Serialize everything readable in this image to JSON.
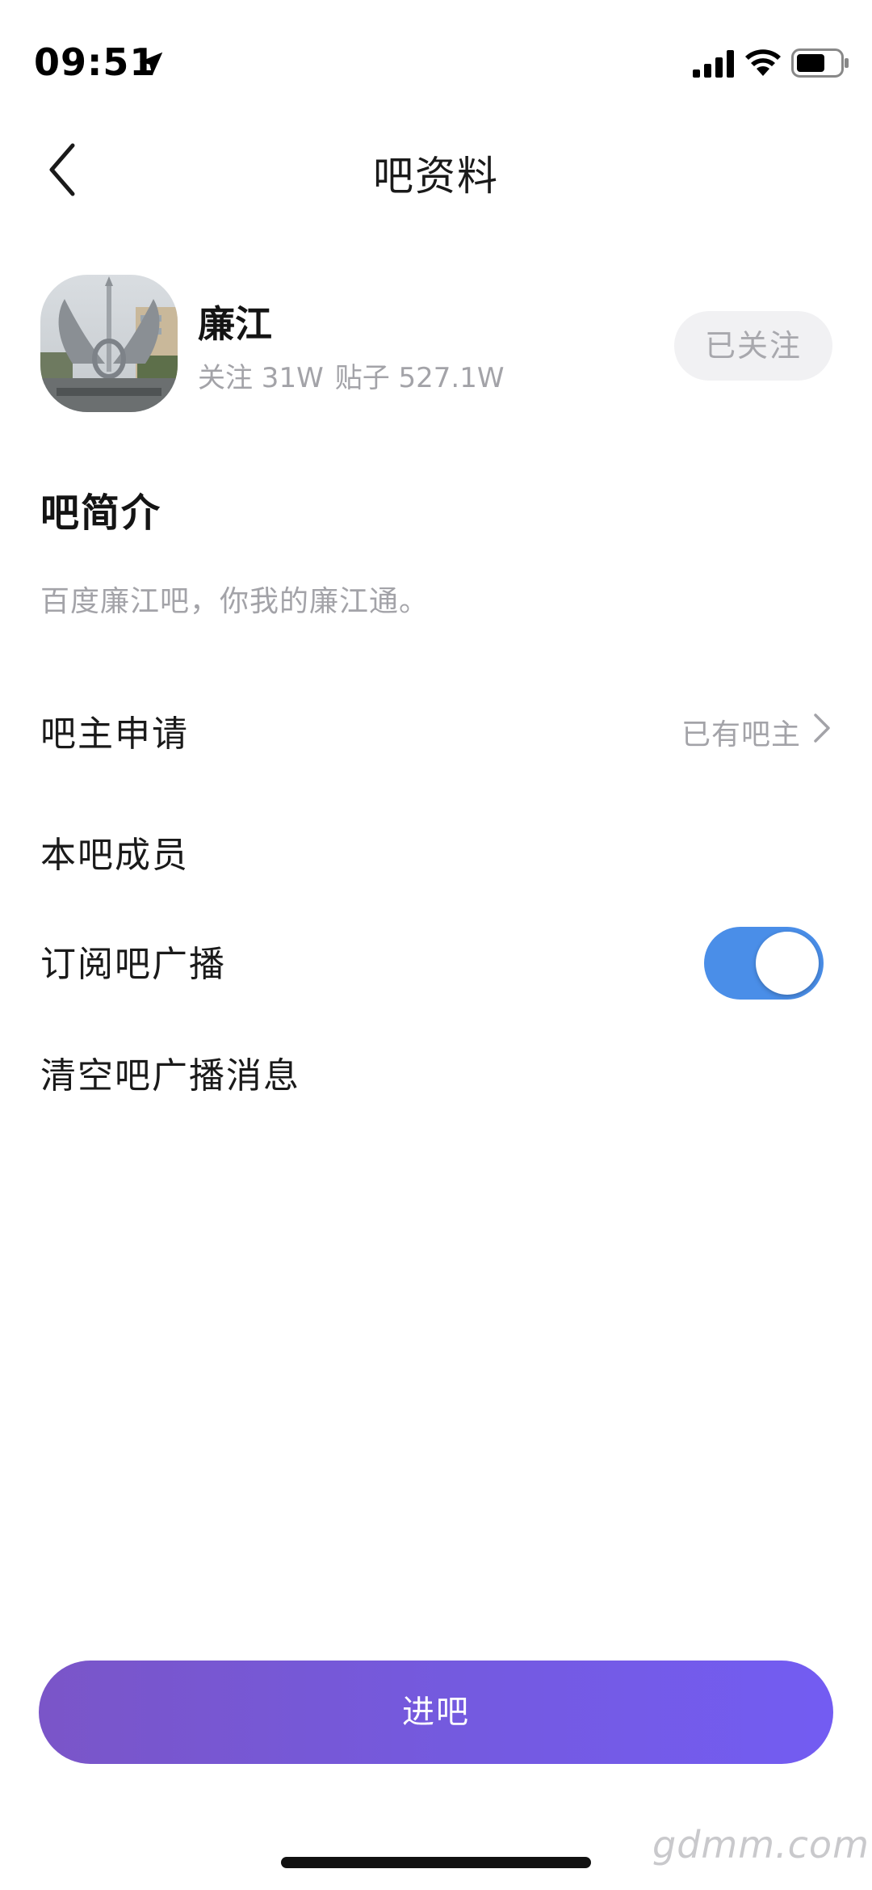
{
  "status_bar": {
    "time": "09:51",
    "icons": [
      "location-arrow-icon",
      "signal-icon",
      "wifi-icon",
      "battery-icon"
    ]
  },
  "nav": {
    "title": "吧资料",
    "back_icon": "chevron-left-icon"
  },
  "forum": {
    "name": "廉江",
    "followers": "关注 31W",
    "posts": "贴子 527.1W",
    "follow_state": "已关注"
  },
  "intro": {
    "title": "吧简介",
    "text": "百度廉江吧，你我的廉江通。"
  },
  "rows": [
    {
      "label": "吧主申请",
      "value": "已有吧主"
    },
    {
      "label": "本吧成员"
    },
    {
      "label": "订阅吧广播",
      "toggle_on": true
    },
    {
      "label": "清空吧广播消息"
    }
  ],
  "enter_button": "进吧",
  "watermark": "gdmm.com",
  "colors": {
    "accent_start": "#7a55c8",
    "accent_end": "#735cf2",
    "toggle_on": "#4a8ee8",
    "secondary_text": "#a3a3a8"
  }
}
